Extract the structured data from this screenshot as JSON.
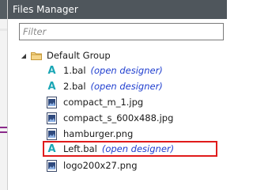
{
  "panel": {
    "title": "Files Manager"
  },
  "filter": {
    "placeholder": "Filter"
  },
  "tree": {
    "group_label": "Default Group",
    "items": [
      {
        "label": "1.bal",
        "icon": "layout-icon",
        "designer": "(open designer)"
      },
      {
        "label": "2.bal",
        "icon": "layout-icon",
        "designer": "(open designer)"
      },
      {
        "label": "compact_m_1.jpg",
        "icon": "image-file-icon"
      },
      {
        "label": "compact_s_600x488.jpg",
        "icon": "image-file-icon"
      },
      {
        "label": "hamburger.png",
        "icon": "image-file-icon"
      },
      {
        "label": "Left.bal",
        "icon": "layout-icon",
        "designer": "(open designer)"
      },
      {
        "label": "logo200x27.png",
        "icon": "image-file-icon"
      }
    ]
  },
  "colors": {
    "titlebar": "#4f565c",
    "layout_icon": "#1aa6b5",
    "designer_link": "#1f3ecf",
    "highlight_border": "#e01b1b"
  }
}
